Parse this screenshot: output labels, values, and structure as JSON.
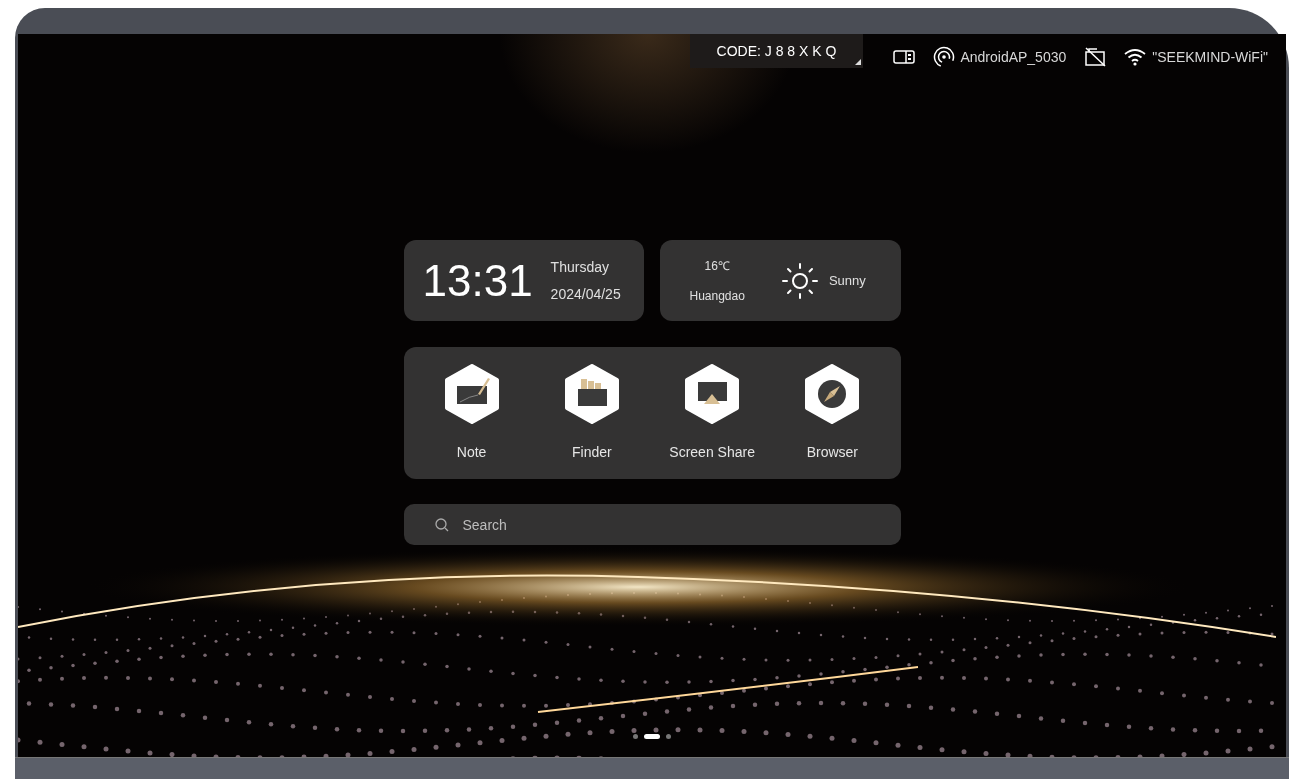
{
  "status_bar": {
    "code": "CODE:  J 8 8 X K Q",
    "hotspot": "AndroidAP_5030",
    "wifi": "\"SEEKMIND-WiFi\""
  },
  "clock": {
    "time": "13:31",
    "weekday": "Thursday",
    "date": "2024/04/25"
  },
  "weather": {
    "temperature": "16℃",
    "city": "Huangdao",
    "condition": "Sunny"
  },
  "apps": [
    {
      "kind": "note",
      "label": "Note"
    },
    {
      "kind": "finder",
      "label": "Finder"
    },
    {
      "kind": "screen_share",
      "label": "Screen Share"
    },
    {
      "kind": "browser",
      "label": "Browser"
    }
  ],
  "search": {
    "placeholder": "Search"
  },
  "pages": [
    {
      "selected": false
    },
    {
      "selected": true
    },
    {
      "selected": false
    }
  ]
}
